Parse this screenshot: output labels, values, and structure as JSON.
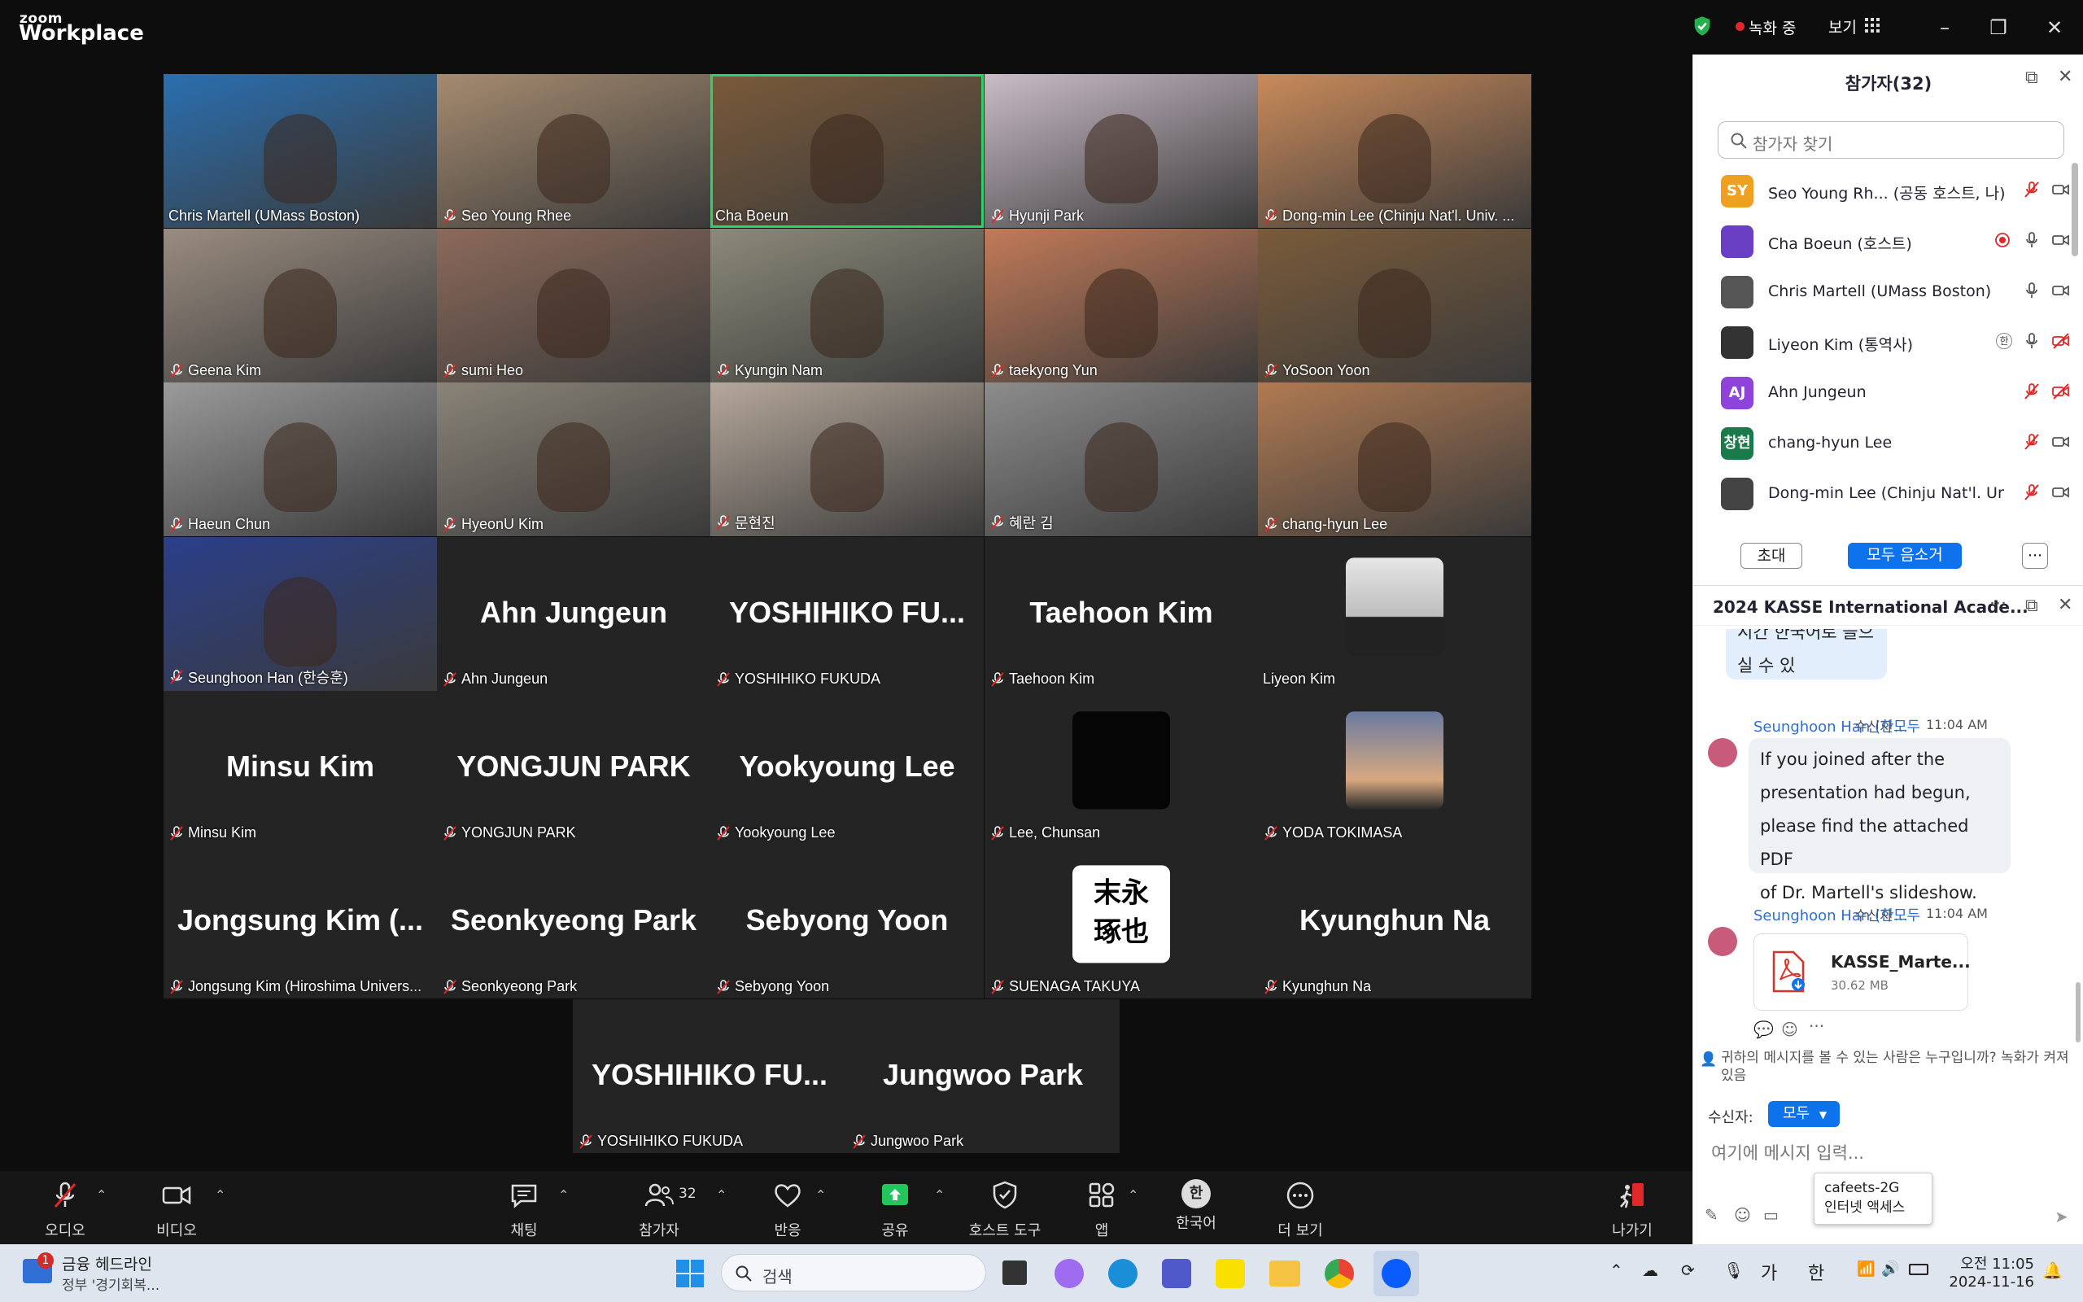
{
  "titlebar": {
    "logo_small": "zoom",
    "logo_big": "Workplace",
    "recording": "녹화 중",
    "view": "보기"
  },
  "gallery": {
    "tiles": [
      {
        "name": "Chris Martell (UMass Boston)",
        "big": "",
        "muted": false,
        "kind": "video"
      },
      {
        "name": "Seo Young Rhee",
        "big": "",
        "muted": true,
        "kind": "video"
      },
      {
        "name": "Cha Boeun",
        "big": "",
        "muted": false,
        "kind": "video",
        "active": true
      },
      {
        "name": "Hyunji Park",
        "big": "",
        "muted": true,
        "kind": "video"
      },
      {
        "name": "Dong-min Lee (Chinju Nat'l. Univ. ...",
        "big": "",
        "muted": true,
        "kind": "video"
      },
      {
        "name": "Geena Kim",
        "big": "",
        "muted": true,
        "kind": "video"
      },
      {
        "name": "sumi Heo",
        "big": "",
        "muted": true,
        "kind": "video"
      },
      {
        "name": "Kyungin Nam",
        "big": "",
        "muted": true,
        "kind": "video"
      },
      {
        "name": "taekyong Yun",
        "big": "",
        "muted": true,
        "kind": "video"
      },
      {
        "name": "YoSoon Yoon",
        "big": "",
        "muted": true,
        "kind": "video"
      },
      {
        "name": "Haeun Chun",
        "big": "",
        "muted": true,
        "kind": "video"
      },
      {
        "name": "HyeonU Kim",
        "big": "",
        "muted": true,
        "kind": "video"
      },
      {
        "name": "문현진",
        "big": "",
        "muted": true,
        "kind": "video"
      },
      {
        "name": "혜란 김",
        "big": "",
        "muted": true,
        "kind": "video"
      },
      {
        "name": "chang-hyun Lee",
        "big": "",
        "muted": true,
        "kind": "video"
      },
      {
        "name": "Seunghoon Han (한승훈)",
        "big": "",
        "muted": true,
        "kind": "video"
      },
      {
        "name": "Ahn Jungeun",
        "big": "Ahn Jungeun",
        "muted": true,
        "kind": "name"
      },
      {
        "name": "YOSHIHIKO FUKUDA",
        "big": "YOSHIHIKO  FU...",
        "muted": true,
        "kind": "name"
      },
      {
        "name": "Taehoon Kim",
        "big": "Taehoon Kim",
        "muted": true,
        "kind": "name"
      },
      {
        "name": "Liyeon Kim",
        "big": "",
        "muted": false,
        "kind": "avatar"
      },
      {
        "name": "Minsu Kim",
        "big": "Minsu Kim",
        "muted": true,
        "kind": "name"
      },
      {
        "name": "YONGJUN PARK",
        "big": "YONGJUN PARK",
        "muted": true,
        "kind": "name"
      },
      {
        "name": "Yookyoung Lee",
        "big": "Yookyoung Lee",
        "muted": true,
        "kind": "name"
      },
      {
        "name": "Lee, Chunsan",
        "big": "",
        "muted": true,
        "kind": "avatar"
      },
      {
        "name": "YODA TOKIMASA",
        "big": "",
        "muted": true,
        "kind": "avatar"
      },
      {
        "name": "Jongsung Kim (Hiroshima Univers...",
        "big": "Jongsung  Kim  (...",
        "muted": true,
        "kind": "name"
      },
      {
        "name": "Seonkyeong Park",
        "big": "Seonkyeong Park",
        "muted": true,
        "kind": "name"
      },
      {
        "name": "Sebyong Yoon",
        "big": "Sebyong Yoon",
        "muted": true,
        "kind": "name"
      },
      {
        "name": "SUENAGA TAKUYA",
        "big": "",
        "muted": true,
        "kind": "avatar"
      },
      {
        "name": "Kyunghun Na",
        "big": "Kyunghun Na",
        "muted": true,
        "kind": "name"
      },
      {
        "name": "YOSHIHIKO FUKUDA",
        "big": "YOSHIHIKO  FU...",
        "muted": true,
        "kind": "name"
      },
      {
        "name": "Jungwoo Park",
        "big": "Jungwoo Park",
        "muted": true,
        "kind": "name"
      }
    ],
    "avatar_text_suenaga": "末永\n琢也"
  },
  "toolbar": {
    "audio": "오디오",
    "video": "비디오",
    "chat": "채팅",
    "participants": "참가자",
    "participants_count": "32",
    "reactions": "반응",
    "share": "공유",
    "host_tools": "호스트 도구",
    "apps": "앱",
    "language": "한국어",
    "language_glyph": "한",
    "more": "더 보기",
    "leave": "나가기"
  },
  "participants_panel": {
    "title": "참가자(32)",
    "search_placeholder": "참가자 찾기",
    "rows": [
      {
        "initials": "SY",
        "color": "#f0a020",
        "name": "Seo Young Rh... (공동 호스트, 나)",
        "mic": "muted",
        "cam": "on"
      },
      {
        "initials": "",
        "color": "#6a3fc4",
        "name": "Cha Boeun (호스트)",
        "mic": "on",
        "cam": "on",
        "rec": true
      },
      {
        "initials": "",
        "color": "#555555",
        "name": "Chris Martell (UMass Boston)",
        "mic": "on",
        "cam": "on"
      },
      {
        "initials": "",
        "color": "#333333",
        "name": "Liyeon Kim (통역사)",
        "mic": "on",
        "cam": "off",
        "lang": "한"
      },
      {
        "initials": "AJ",
        "color": "#8e44d9",
        "name": "Ahn Jungeun",
        "mic": "muted",
        "cam": "off"
      },
      {
        "initials": "창현",
        "color": "#1a7a4a",
        "name": "chang-hyun Lee",
        "mic": "muted",
        "cam": "on"
      },
      {
        "initials": "",
        "color": "#444444",
        "name": "Dong-min Lee (Chinju Nat'l. Un...",
        "mic": "muted",
        "cam": "on"
      }
    ],
    "invite": "초대",
    "mute_all": "모두 음소거"
  },
  "chat": {
    "title": "2024 KASSE International Acade...",
    "partial_bubble": "시간 한국어로 들으실 수 있\n습니다.",
    "messages": [
      {
        "sender": "Seunghoon Han (한...",
        "to_label": "수신자",
        "to": "모두",
        "time": "11:04 AM",
        "text": "If you joined after the\npresentation had begun,\nplease find the attached PDF\nof Dr. Martell's slideshow."
      },
      {
        "sender": "Seunghoon Han (한...",
        "to_label": "수신자",
        "to": "모두",
        "time": "11:04 AM",
        "file": "KASSE_Marte...",
        "size": "30.62 MB"
      }
    ],
    "notice": "귀하의 메시지를 볼 수 있는 사람은 누구입니까? 녹화가 켜져 있음",
    "recipient_label": "수신자:",
    "recipient": "모두",
    "input_placeholder": "여기에 메시지 입력...",
    "tooltip_line1": "cafeets-2G",
    "tooltip_line2": "인터넷 액세스"
  },
  "taskbar": {
    "news_title": "금융 헤드라인",
    "news_sub": "정부 '경기회복...",
    "news_badge": "1",
    "search": "검색",
    "ime_ga": "가",
    "ime_han": "한",
    "time": "오전 11:05",
    "date": "2024-11-16"
  }
}
